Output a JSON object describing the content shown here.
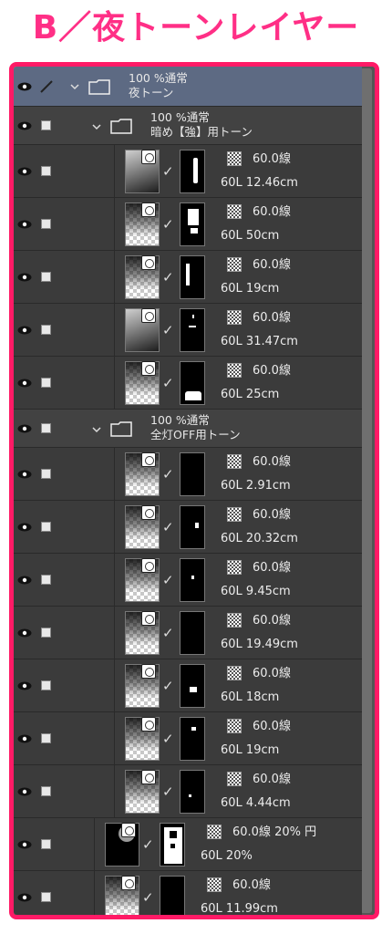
{
  "title": "B／夜トーンレイヤー",
  "groups": {
    "night": {
      "line1": "100 %通常",
      "line2": "夜トーン"
    },
    "dark": {
      "line1": "100 %通常",
      "line2": "暗め【強】用トーン"
    },
    "off": {
      "line1": "100 %通常",
      "line2": "全灯OFF用トーン"
    }
  },
  "layers": [
    {
      "tone": "60.0線",
      "info": "60L 12.46cm"
    },
    {
      "tone": "60.0線",
      "info": "60L 50cm"
    },
    {
      "tone": "60.0線",
      "info": "60L 19cm"
    },
    {
      "tone": "60.0線",
      "info": "60L 31.47cm"
    },
    {
      "tone": "60.0線",
      "info": "60L 25cm"
    },
    {
      "tone": "60.0線",
      "info": "60L 2.91cm"
    },
    {
      "tone": "60.0線",
      "info": "60L 20.32cm"
    },
    {
      "tone": "60.0線",
      "info": "60L 9.45cm"
    },
    {
      "tone": "60.0線",
      "info": "60L 19.49cm"
    },
    {
      "tone": "60.0線",
      "info": "60L 18cm"
    },
    {
      "tone": "60.0線",
      "info": "60L 19cm"
    },
    {
      "tone": "60.0線",
      "info": "60L 4.44cm"
    },
    {
      "tone": "60.0線 20% 円",
      "info": "60L 20%"
    },
    {
      "tone": "60.0線",
      "info": "60L 11.99cm"
    }
  ],
  "icons": {
    "eye": "eye-icon",
    "lock": "lock-checkbox",
    "pen": "pen-icon",
    "folder": "folder-icon",
    "chevron": "chevron-down-icon",
    "badge": "tone-layer-icon",
    "check": "mask-link-check-icon",
    "tone": "tone-pattern-icon"
  },
  "colors": {
    "title": "#ff2f86",
    "frame": "#ff1a66",
    "active_group": "#5d6a83"
  }
}
